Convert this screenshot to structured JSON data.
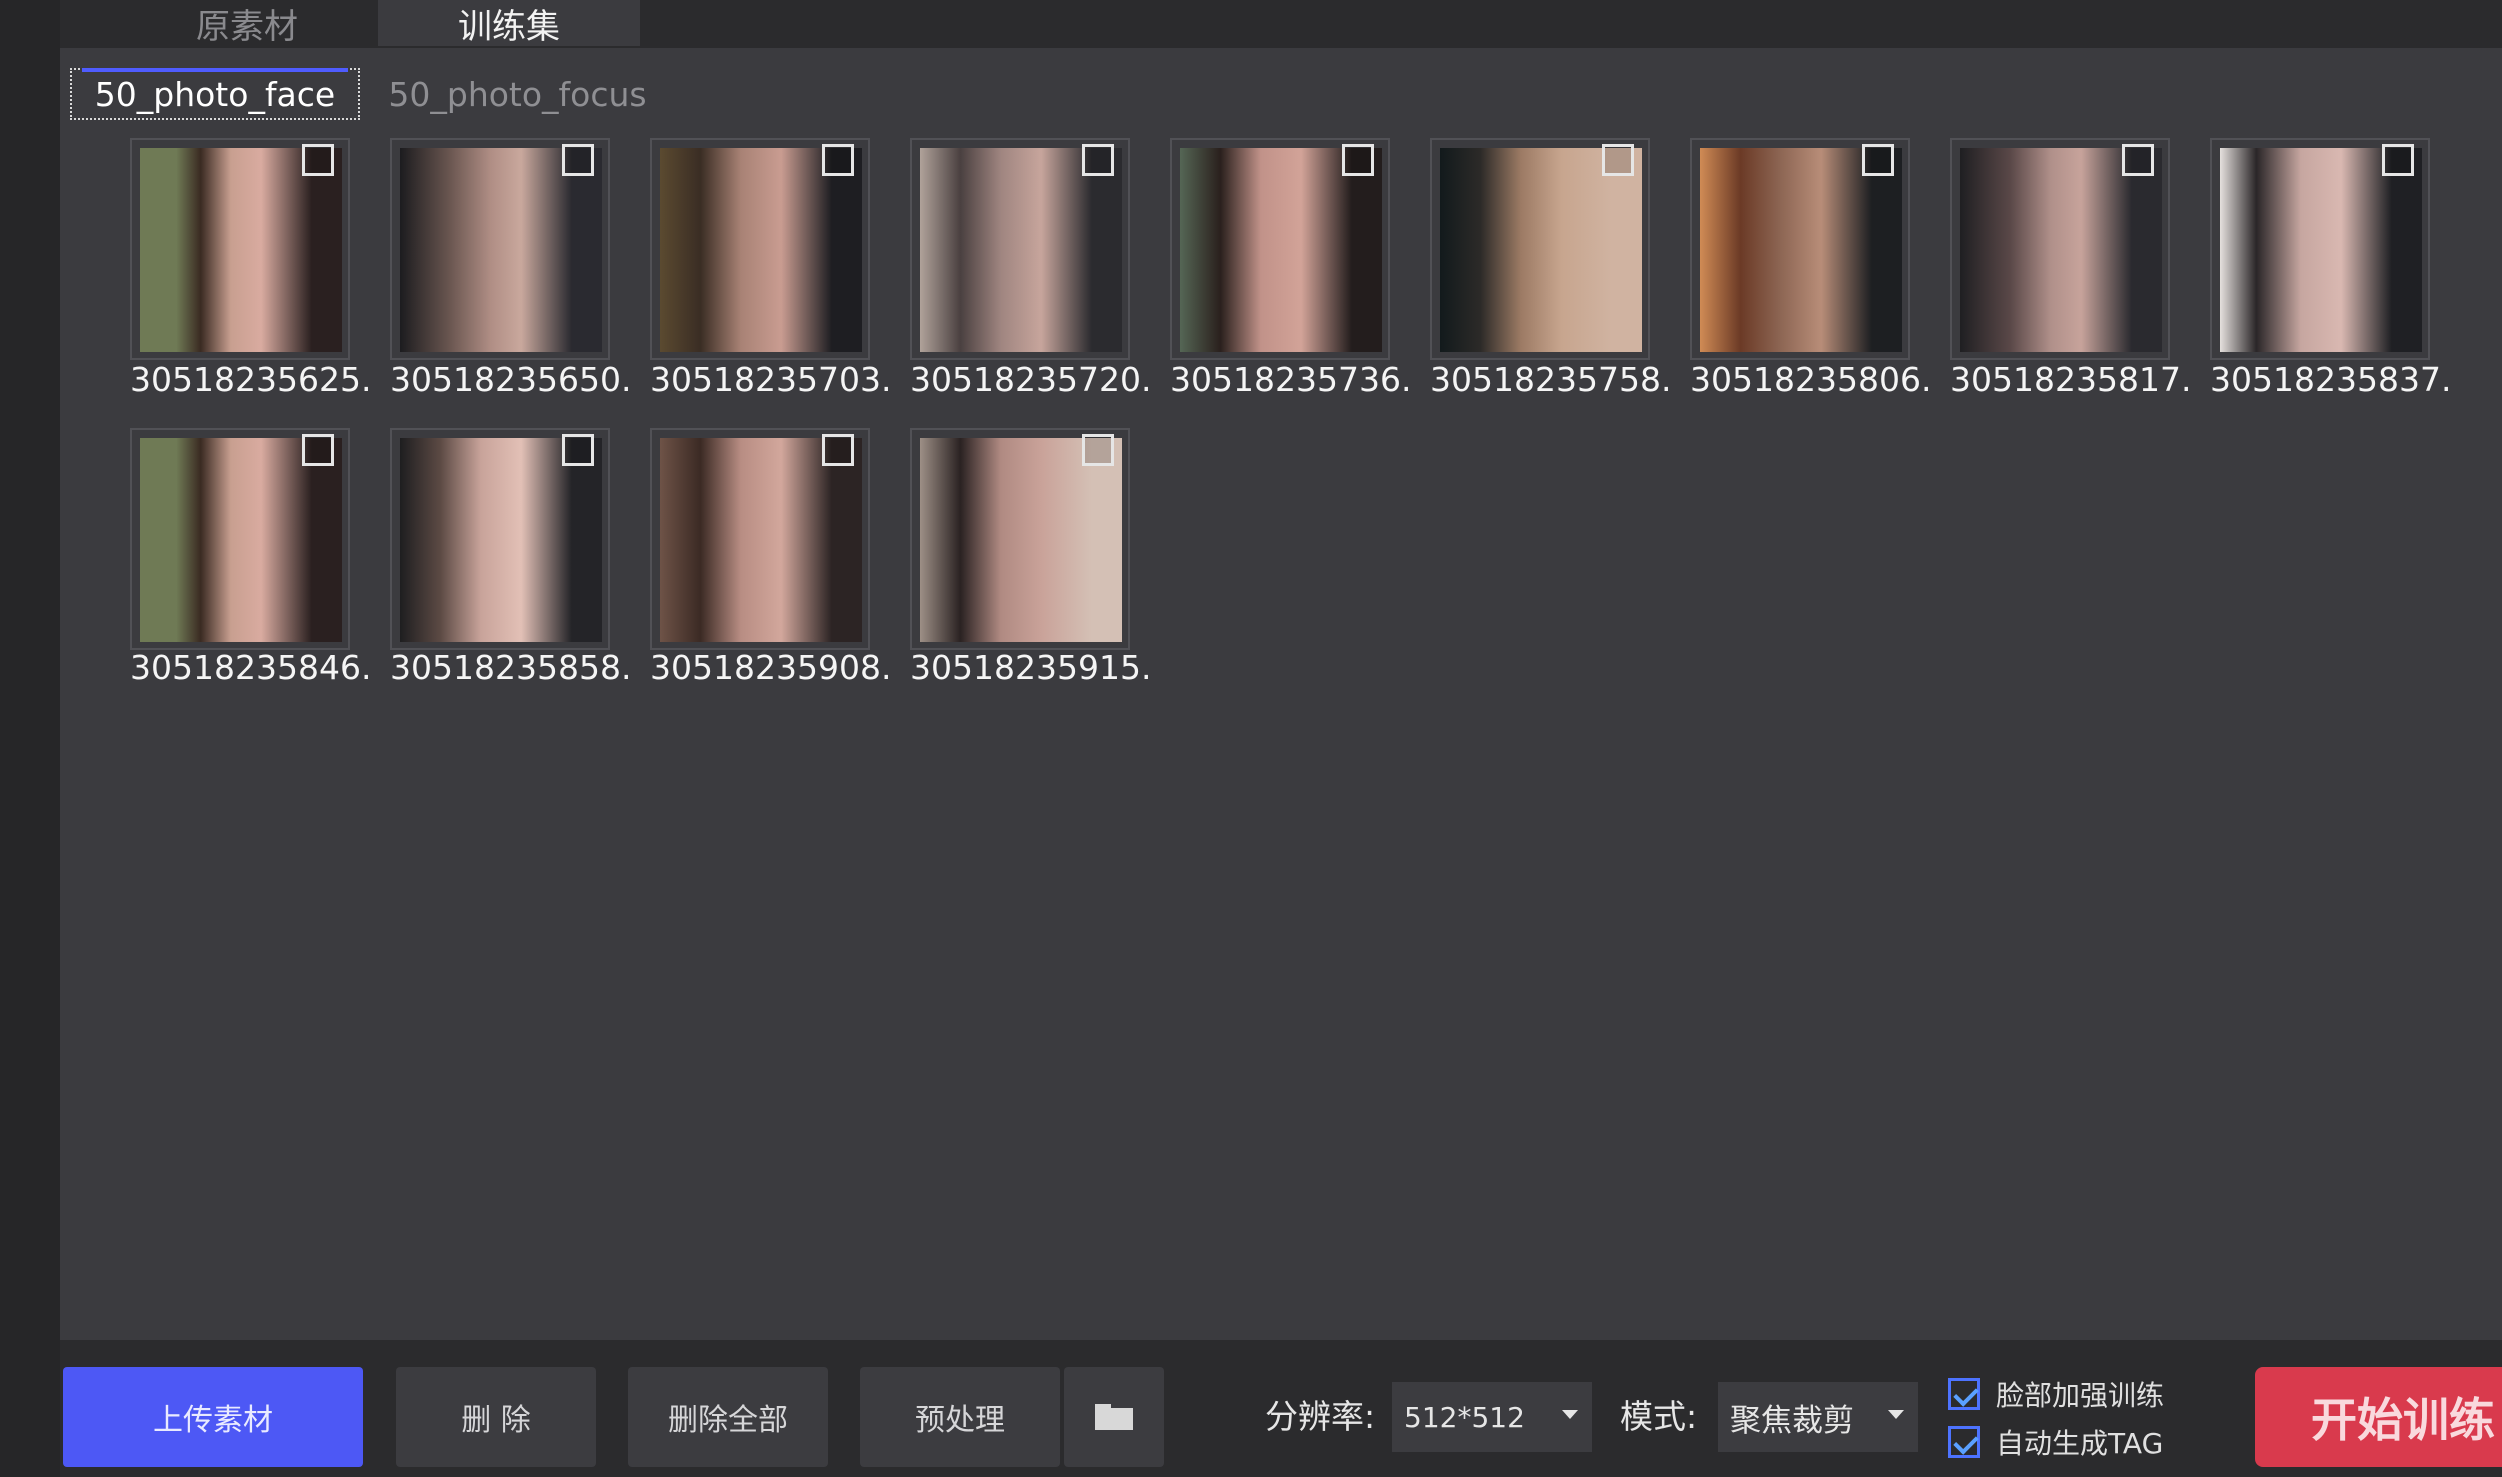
{
  "top_tabs": [
    {
      "label": "原素材",
      "active": false
    },
    {
      "label": "训练集",
      "active": true
    }
  ],
  "sub_tabs": [
    {
      "label": "50_photo_face",
      "active": true
    },
    {
      "label": "50_photo_focus",
      "active": false
    }
  ],
  "images": [
    {
      "name": "30518235625.|",
      "checked": false
    },
    {
      "name": "30518235650.|",
      "checked": false
    },
    {
      "name": "30518235703.|",
      "checked": false
    },
    {
      "name": "30518235720.|",
      "checked": false
    },
    {
      "name": "30518235736.|",
      "checked": false
    },
    {
      "name": "30518235758.|",
      "checked": false
    },
    {
      "name": "30518235806.|",
      "checked": false
    },
    {
      "name": "30518235817.|",
      "checked": false
    },
    {
      "name": "30518235837.|",
      "checked": false
    },
    {
      "name": "30518235846.|",
      "checked": false
    },
    {
      "name": "30518235858.|",
      "checked": false
    },
    {
      "name": "30518235908.|",
      "checked": false
    },
    {
      "name": "30518235915.|",
      "checked": false
    }
  ],
  "toolbar": {
    "upload": "上传素材",
    "delete": "删 除",
    "delete_all": "删除全部",
    "preprocess": "预处理",
    "folder_icon": "folder-icon",
    "resolution_label": "分辨率:",
    "resolution_value": "512*512",
    "mode_label": "模式:",
    "mode_value": "聚焦裁剪",
    "face_enhance": "脸部加强训练",
    "face_enhance_checked": true,
    "auto_tag": "自动生成TAG",
    "auto_tag_checked": true,
    "start": "开始训练"
  },
  "colors": {
    "primary": "#4d58f5",
    "start": "#d93a4d",
    "panel": "#3b3b3f",
    "background": "#2b2b2d"
  }
}
